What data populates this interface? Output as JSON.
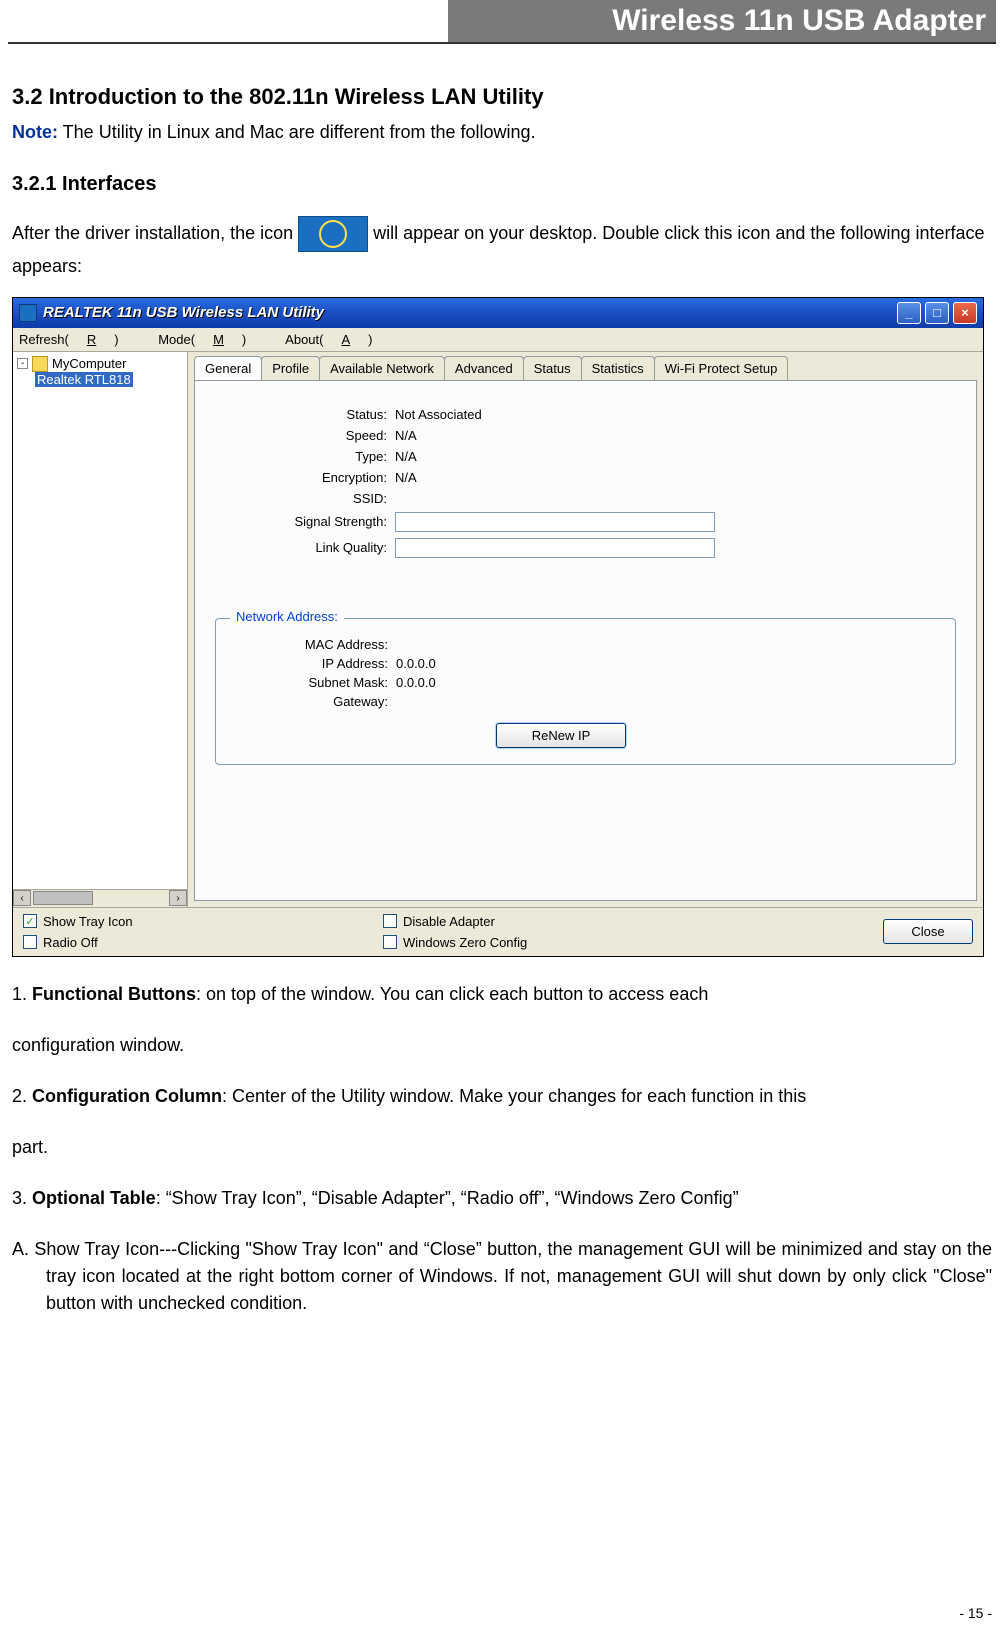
{
  "header": {
    "title": "Wireless 11n USB Adapter"
  },
  "section": {
    "h32": "3.2    Introduction to the 802.11n Wireless LAN Utility",
    "note_label": "Note:",
    "note_text": " The Utility in Linux and Mac are different from the following.",
    "h321": "3.2.1    Interfaces",
    "p1a": "After the driver installation, the icon ",
    "p1b": " will appear on your desktop. Double click this icon and the following interface appears:"
  },
  "window": {
    "title": "REALTEK 11n USB Wireless LAN Utility",
    "ctrl_min": "_",
    "ctrl_max": "□",
    "ctrl_close": "×",
    "menu": {
      "refresh_pre": "Refresh(",
      "refresh_u": "R",
      "refresh_post": ")",
      "mode_pre": "Mode(",
      "mode_u": "M",
      "mode_post": ")",
      "about_pre": "About(",
      "about_u": "A",
      "about_post": ")"
    },
    "tree": {
      "root": "MyComputer",
      "child": "Realtek RTL818"
    },
    "tabs": [
      "General",
      "Profile",
      "Available Network",
      "Advanced",
      "Status",
      "Statistics",
      "Wi-Fi Protect Setup"
    ],
    "general": {
      "status_k": "Status:",
      "status_v": "Not Associated",
      "speed_k": "Speed:",
      "speed_v": "N/A",
      "type_k": "Type:",
      "type_v": "N/A",
      "enc_k": "Encryption:",
      "enc_v": "N/A",
      "ssid_k": "SSID:",
      "ssid_v": "",
      "sig_k": "Signal Strength:",
      "link_k": "Link Quality:"
    },
    "netaddr": {
      "legend": "Network Address:",
      "mac_k": "MAC Address:",
      "mac_v": "",
      "ip_k": "IP Address:",
      "ip_v": "0.0.0.0",
      "mask_k": "Subnet Mask:",
      "mask_v": "0.0.0.0",
      "gw_k": "Gateway:",
      "gw_v": "",
      "renew": "ReNew IP"
    },
    "checks": {
      "tray": "Show Tray Icon",
      "radio": "Radio Off",
      "disable": "Disable Adapter",
      "wzc": "Windows Zero Config"
    },
    "close": "Close"
  },
  "body": {
    "p1_pre": "1. ",
    "p1_b": "Functional Buttons",
    "p1_post": ": on top of the window. You can click each button to access each",
    "p1_cont": "configuration window.",
    "p2_pre": "2. ",
    "p2_b": "Configuration Column",
    "p2_post": ": Center of the Utility window. Make your changes for each function in this",
    "p2_cont": "part.",
    "p3_pre": "3. ",
    "p3_b": "Optional Table",
    "p3_post": ": “Show Tray Icon”, “Disable Adapter”, “Radio off”, “Windows Zero Config”",
    "pA": "A. Show Tray Icon---Clicking \"Show Tray Icon\" and “Close” button, the management GUI will be minimized and stay on the tray icon located at the right bottom corner of Windows. If not, management GUI will shut down by only click \"Close\" button with unchecked condition."
  },
  "page_number": "- 15 -"
}
